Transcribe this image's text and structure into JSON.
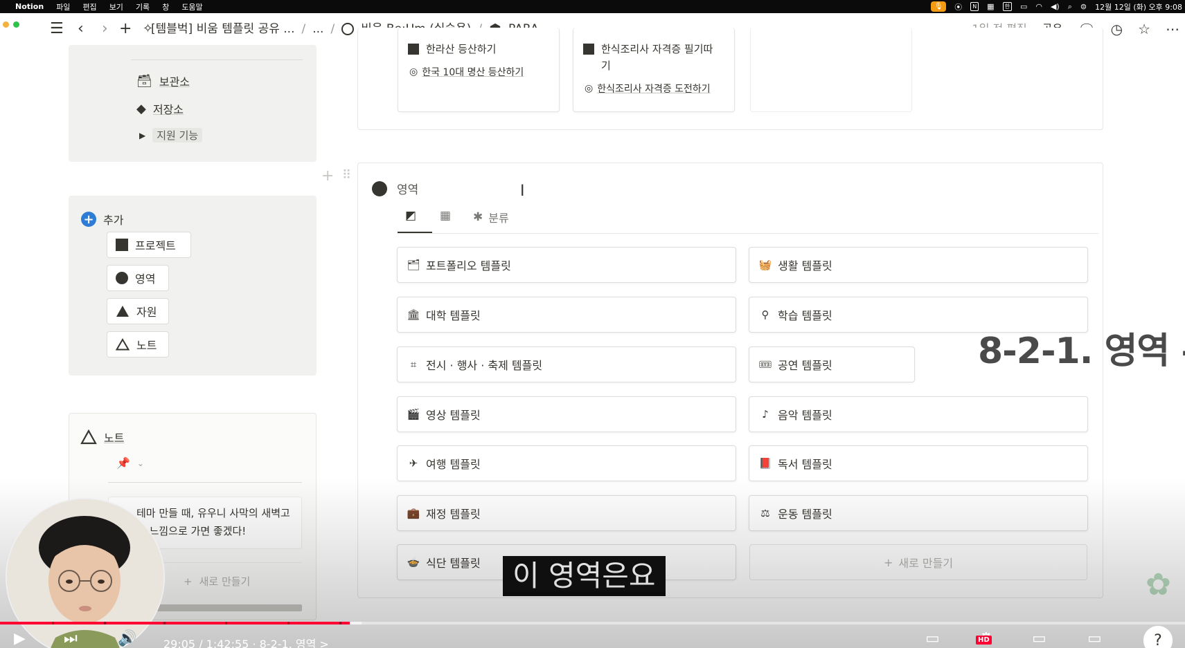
{
  "menubar": {
    "app_name": "Notion",
    "items": [
      "파일",
      "편집",
      "보기",
      "기록",
      "창",
      "도움말"
    ],
    "tray_icons": [
      "microphone-icon",
      "record-icon",
      "notion-tray-icon",
      "keyboard-icon",
      "input-han-icon",
      "battery-icon",
      "wifi-icon",
      "volume-icon",
      "spotlight-icon",
      "control-center-icon"
    ],
    "input_method": "한",
    "clock": "12월 12일 (화) 오후 9:08"
  },
  "topbar": {
    "breadcrumb": [
      "[템블벅] 비움 템플릿 공유 ...",
      "...",
      "비움 Be:Um (실습용)",
      "PARA"
    ],
    "edited": "1일 전 편집",
    "share": "공유"
  },
  "sidebar": {
    "archive": "보관소",
    "storage": "저장소",
    "support": "지원 기능",
    "add_title": "추가",
    "add_buttons": [
      "프로젝트",
      "영역",
      "자원",
      "노트"
    ],
    "note_title": "노트",
    "note_text_1": "테마 만들 때, 유우니 사막의 새벽고",
    "note_text_2": "한 느낌으로 가면 좋겠다!",
    "new_label": "새로 만들기"
  },
  "top_cards": {
    "card1_title": "한라산 등산하기",
    "card1_goal": "한국 10대 명산 등산하기",
    "card2_title_1": "한식조리사 자격증 필기따",
    "card2_title_2": "기",
    "card2_goal": "한식조리사 자격증 도전하기"
  },
  "area": {
    "title": "영역",
    "tabs": {
      "gallery_icon": "gallery-icon",
      "table_icon": "table-icon",
      "category": "분류"
    },
    "left_items": [
      {
        "label": "포트폴리오 템플릿",
        "icon": "🗂"
      },
      {
        "label": "대학 템플릿",
        "icon": "🏛"
      },
      {
        "label": "전시 · 행사 · 축제 템플릿",
        "icon": "⌗"
      },
      {
        "label": "영상 템플릿",
        "icon": "🎬"
      },
      {
        "label": "여행 템플릿",
        "icon": "✈"
      },
      {
        "label": "재정 템플릿",
        "icon": "💼"
      },
      {
        "label": "식단 템플릿",
        "icon": "🍲"
      }
    ],
    "right_items": [
      {
        "label": "생활 템플릿",
        "icon": "🧺"
      },
      {
        "label": "학습 템플릿",
        "icon": "⚲"
      },
      {
        "label": "공연 템플릿",
        "icon": "🎟"
      },
      {
        "label": "음악 템플릿",
        "icon": "♪"
      },
      {
        "label": "독서 템플릿",
        "icon": "📕"
      },
      {
        "label": "운동 템플릿",
        "icon": "⚖"
      }
    ],
    "new_label": "새로 만들기"
  },
  "overlay": {
    "section_title": "8-2-1. 영역 –",
    "caption": "이 영역은요"
  },
  "player": {
    "progress": 0.295,
    "time": "29:05 / 1:42:55 · 8-2-1. 영역 >"
  },
  "colors": {
    "accent_blue": "#2e7cd6",
    "progress_red": "#ff0033",
    "panel_gray": "#f1f1ef"
  }
}
